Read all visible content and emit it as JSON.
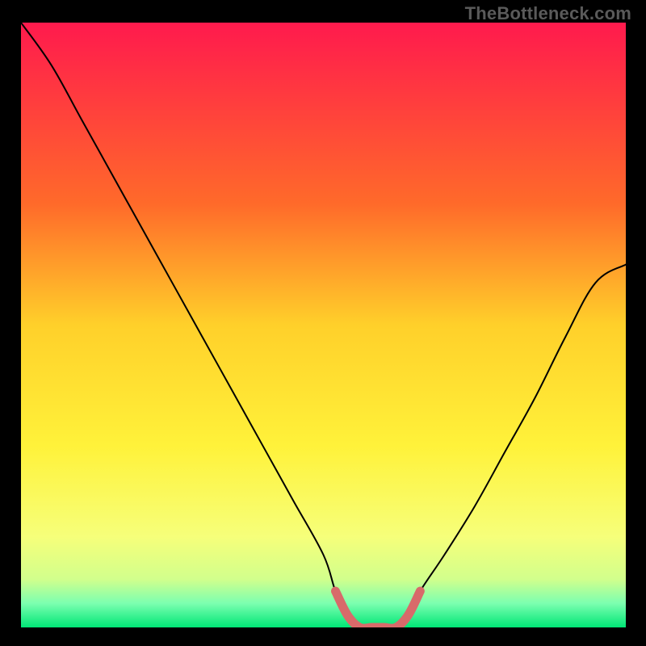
{
  "watermark": "TheBottleneck.com",
  "chart_data": {
    "type": "line",
    "title": "",
    "xlabel": "",
    "ylabel": "",
    "xlim": [
      0,
      100
    ],
    "ylim": [
      0,
      100
    ],
    "series": [
      {
        "name": "curve",
        "x": [
          0,
          5,
          10,
          15,
          20,
          25,
          30,
          35,
          40,
          45,
          50,
          52,
          54,
          56,
          58,
          60,
          62,
          64,
          66,
          70,
          75,
          80,
          85,
          90,
          95,
          100
        ],
        "values": [
          100,
          93,
          84,
          75,
          66,
          57,
          48,
          39,
          30,
          21,
          12,
          6,
          2,
          0,
          0,
          0,
          0,
          2,
          6,
          12,
          20,
          29,
          38,
          48,
          57,
          60
        ]
      },
      {
        "name": "flat-highlight",
        "x": [
          52,
          54,
          56,
          58,
          60,
          62,
          64,
          66
        ],
        "values": [
          6,
          2,
          0,
          0,
          0,
          0,
          2,
          6
        ]
      }
    ],
    "background_gradient": {
      "stops": [
        {
          "offset": 0.0,
          "color": "#ff1a4d"
        },
        {
          "offset": 0.3,
          "color": "#ff6a2a"
        },
        {
          "offset": 0.5,
          "color": "#ffd02a"
        },
        {
          "offset": 0.7,
          "color": "#fff23a"
        },
        {
          "offset": 0.85,
          "color": "#f6ff7a"
        },
        {
          "offset": 0.92,
          "color": "#d2ff8c"
        },
        {
          "offset": 0.96,
          "color": "#7cffb0"
        },
        {
          "offset": 1.0,
          "color": "#00e676"
        }
      ]
    },
    "highlight_color": "#d86a6a",
    "curve_color": "#000000"
  }
}
